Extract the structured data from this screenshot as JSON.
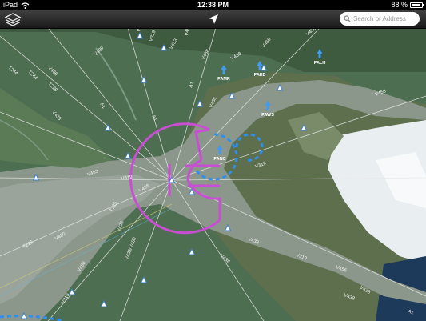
{
  "status_bar": {
    "carrier": "iPad",
    "time": "12:38 PM",
    "battery_text": "88 %",
    "battery_level": 0.88
  },
  "toolbar": {
    "layers_icon": "layers-icon",
    "locate_icon": "location-arrow-icon",
    "search_icon": "search-icon",
    "search_placeholder": "Search or Address"
  },
  "map": {
    "route_labels": [
      "V319",
      "V456",
      "V438",
      "V480",
      "V453",
      "T244",
      "T225",
      "T228",
      "V438",
      "A1",
      "V438",
      "V438",
      "V466",
      "V319",
      "V438",
      "A1",
      "V319",
      "V456",
      "V480",
      "V480",
      "V438",
      "V453",
      "V466",
      "T244",
      "V319",
      "V456",
      "V438",
      "V438/V480",
      "T225",
      "V438",
      "V438",
      "V456",
      "A1",
      "V438",
      "V319",
      "A1",
      "V466"
    ],
    "airport_labels": [
      "PAMR",
      "PAED",
      "PALH",
      "PAWS",
      "PANC"
    ],
    "accent_colors": {
      "airspace_class_c": "#c84ed4",
      "airspace_class_d": "#2f8ff0",
      "airway": "#e8e8e8"
    }
  }
}
